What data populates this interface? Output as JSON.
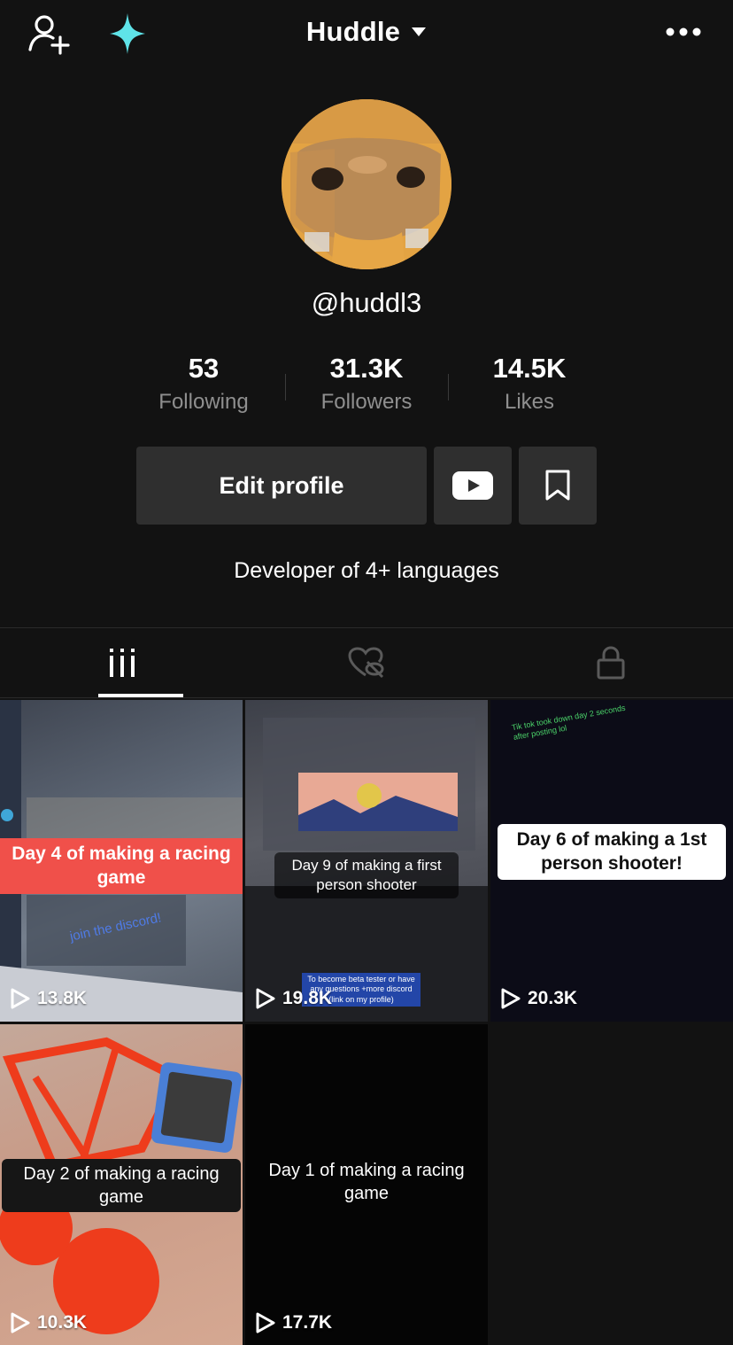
{
  "header": {
    "account_name": "Huddle",
    "icons": [
      "add-friend-icon",
      "sparkle-icon",
      "chevron-down-icon",
      "more-icon"
    ]
  },
  "profile": {
    "handle": "@huddl3",
    "bio": "Developer of 4+ languages",
    "stats": [
      {
        "value": "53",
        "label": "Following"
      },
      {
        "value": "31.3K",
        "label": "Followers"
      },
      {
        "value": "14.5K",
        "label": "Likes"
      }
    ],
    "edit_label": "Edit profile"
  },
  "tabs": [
    {
      "icon": "grid-icon",
      "active": true
    },
    {
      "icon": "liked-hidden-icon",
      "active": false
    },
    {
      "icon": "lock-icon",
      "active": false
    }
  ],
  "videos": [
    {
      "caption": "Day 4 of making a racing game",
      "views": "13.8K",
      "overlay": "join the discord!"
    },
    {
      "caption": "Day 9 of making a first person shooter",
      "views": "19.8K",
      "overlay": "To become beta tester or have any questions +more discord (link on my profile)"
    },
    {
      "caption": "Day 6 of making a 1st person shooter!",
      "views": "20.3K",
      "overlay": "Tik tok took down day 2 seconds after posting lol"
    },
    {
      "caption": "Day 2 of making a racing game",
      "views": "10.3K"
    },
    {
      "caption": "Day 1 of making a racing game",
      "views": "17.7K"
    }
  ],
  "colors": {
    "background": "#121212",
    "accent_sparkle": "#5fe3e8",
    "caption_red": "#f0504a",
    "button_bg": "#2f2f2f"
  }
}
